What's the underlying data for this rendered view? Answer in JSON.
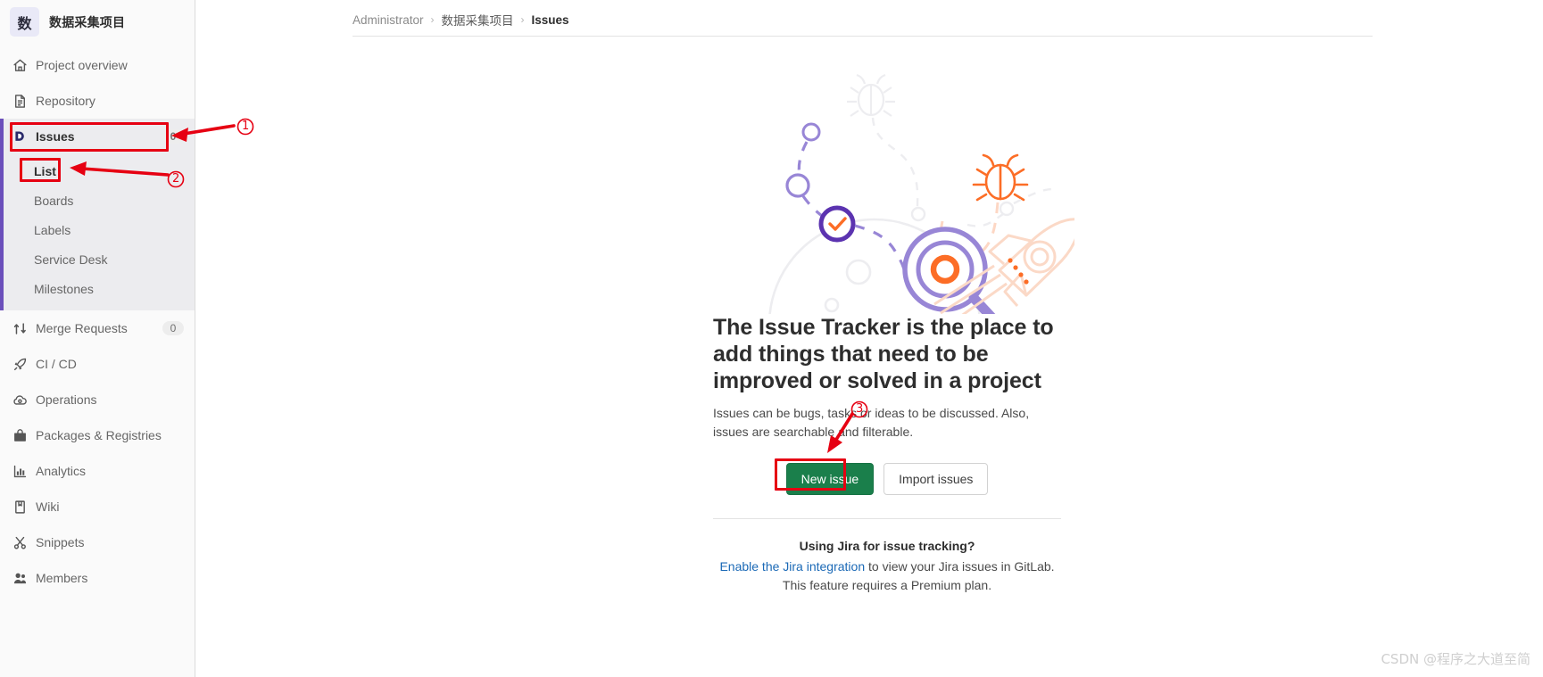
{
  "colors": {
    "accent_purple": "#6b4fbb",
    "primary_green": "#1a7f4b",
    "link_blue": "#1b69b6",
    "annotation_red": "#e60012",
    "sidebar_bg": "#fafafa",
    "sidebar_active_bg": "#ececef"
  },
  "sidebar": {
    "project_initial": "数",
    "project_name": "数据采集项目",
    "items": [
      {
        "label": "Project overview",
        "icon": "home-icon",
        "count": ""
      },
      {
        "label": "Repository",
        "icon": "document-icon",
        "count": ""
      },
      {
        "label": "Issues",
        "icon": "issues-icon",
        "count": "0",
        "active": true
      },
      {
        "label": "Merge Requests",
        "icon": "merge-request-icon",
        "count": "0"
      },
      {
        "label": "CI / CD",
        "icon": "rocket-icon",
        "count": ""
      },
      {
        "label": "Operations",
        "icon": "cloud-gear-icon",
        "count": ""
      },
      {
        "label": "Packages & Registries",
        "icon": "package-icon",
        "count": ""
      },
      {
        "label": "Analytics",
        "icon": "chart-icon",
        "count": ""
      },
      {
        "label": "Wiki",
        "icon": "book-icon",
        "count": ""
      },
      {
        "label": "Snippets",
        "icon": "scissors-icon",
        "count": ""
      },
      {
        "label": "Members",
        "icon": "users-icon",
        "count": ""
      }
    ],
    "issues_subnav": [
      {
        "label": "List",
        "active": true
      },
      {
        "label": "Boards",
        "active": false
      },
      {
        "label": "Labels",
        "active": false
      },
      {
        "label": "Service Desk",
        "active": false
      },
      {
        "label": "Milestones",
        "active": false
      }
    ]
  },
  "breadcrumb": {
    "user": "Administrator",
    "sep": "›",
    "project": "数据采集项目",
    "current": "Issues"
  },
  "empty_state": {
    "title": "The Issue Tracker is the place to add things that need to be improved or solved in a project",
    "description": "Issues can be bugs, tasks or ideas to be discussed. Also, issues are searchable and filterable.",
    "new_issue_button": "New issue",
    "import_issues_button": "Import issues"
  },
  "jira": {
    "heading": "Using Jira for issue tracking?",
    "link_text": "Enable the Jira integration",
    "line1_rest": " to view your Jira issues in GitLab.",
    "line2": "This feature requires a Premium plan."
  },
  "annotations": {
    "marker1": "①",
    "marker2": "②",
    "marker3": "③"
  },
  "watermark": "CSDN @程序之大道至简"
}
